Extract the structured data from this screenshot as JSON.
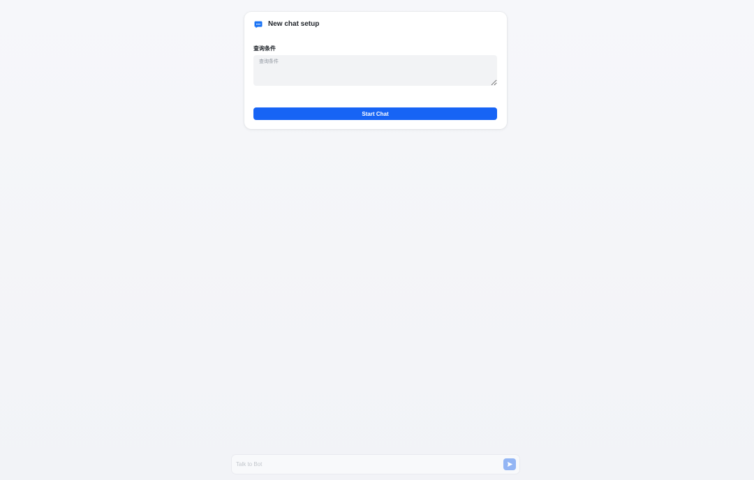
{
  "setup_card": {
    "title": "New chat setup",
    "icon": "chat-bubble-icon",
    "field_label": "查询条件",
    "textarea_placeholder": "查询条件",
    "textarea_value": "",
    "start_button_label": "Start Chat"
  },
  "composer": {
    "input_placeholder": "Talk to Bot",
    "input_value": "",
    "send_icon": "send-icon"
  },
  "colors": {
    "accent": "#1764f5",
    "send_button_disabled": "#93b5f4",
    "icon_blue": "#1a73f5",
    "page_background": "#f4f5f8"
  }
}
